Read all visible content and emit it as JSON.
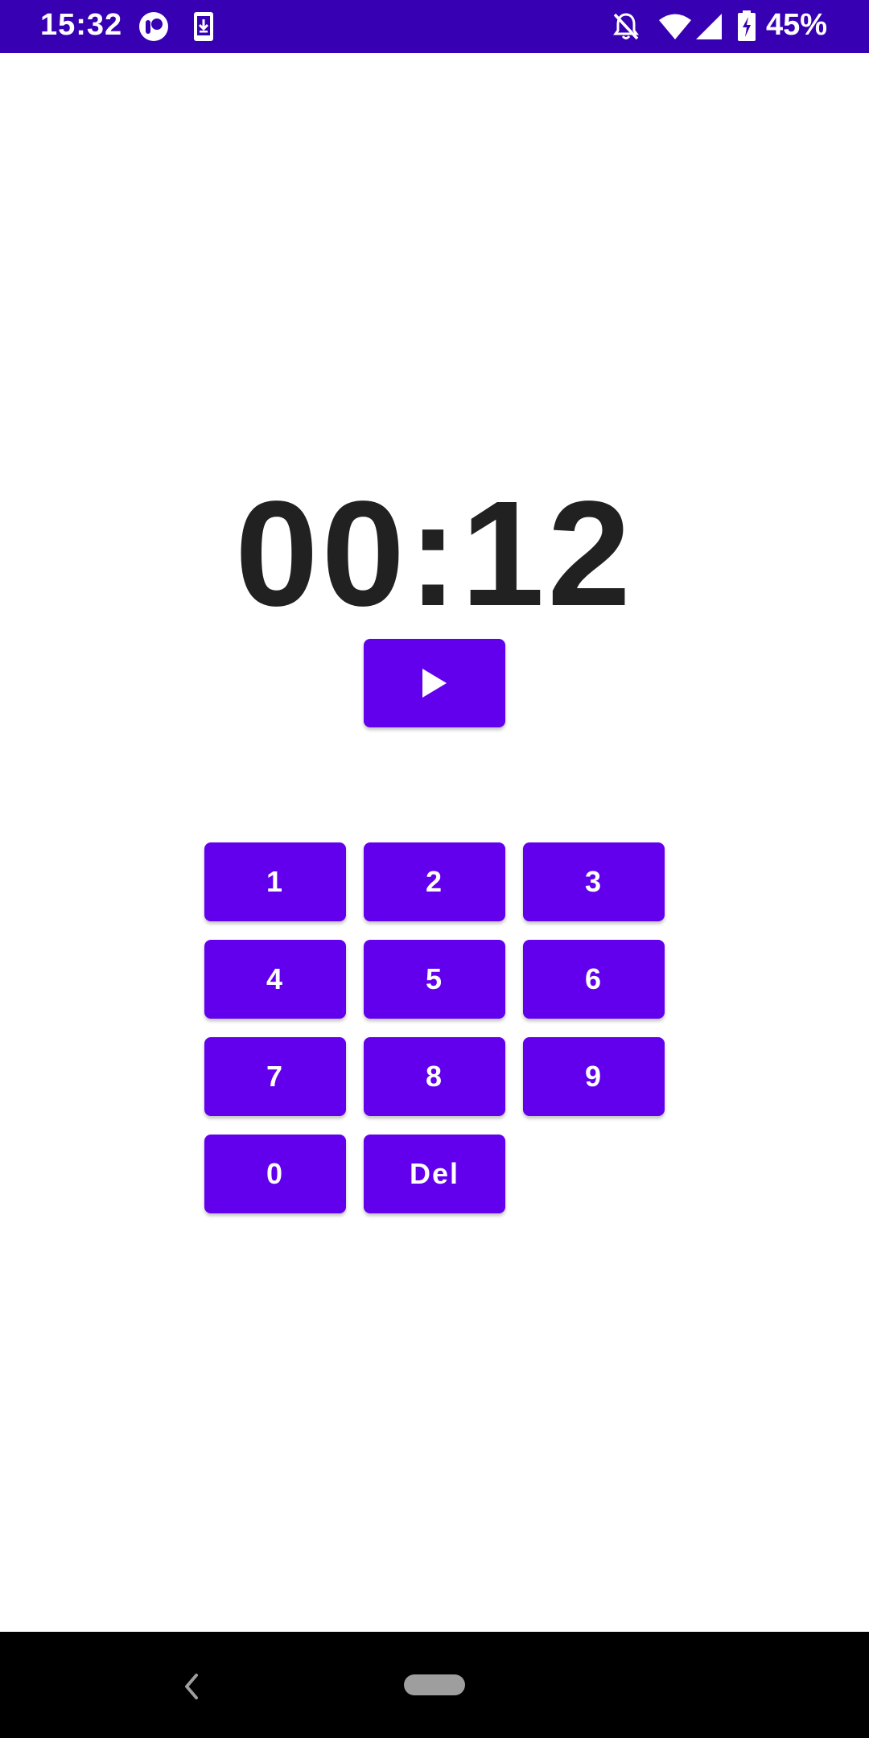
{
  "status_bar": {
    "time": "15:32",
    "battery_percent": "45%",
    "icons": [
      "app-notification-icon",
      "download-notification-icon",
      "notifications-off-icon",
      "wifi-icon",
      "cellular-signal-icon",
      "battery-charging-icon"
    ],
    "background_color": "#3700b3"
  },
  "timer": {
    "display": "00:12",
    "color": "#212121"
  },
  "controls": {
    "play_icon": "play-icon"
  },
  "keypad": {
    "keys": [
      {
        "label": "1"
      },
      {
        "label": "2"
      },
      {
        "label": "3"
      },
      {
        "label": "4"
      },
      {
        "label": "5"
      },
      {
        "label": "6"
      },
      {
        "label": "7"
      },
      {
        "label": "8"
      },
      {
        "label": "9"
      },
      {
        "label": "0"
      },
      {
        "label": "Del"
      }
    ],
    "button_color": "#6200ee"
  },
  "navigation_bar": {
    "icons": [
      "back-icon",
      "home-pill-icon"
    ]
  }
}
